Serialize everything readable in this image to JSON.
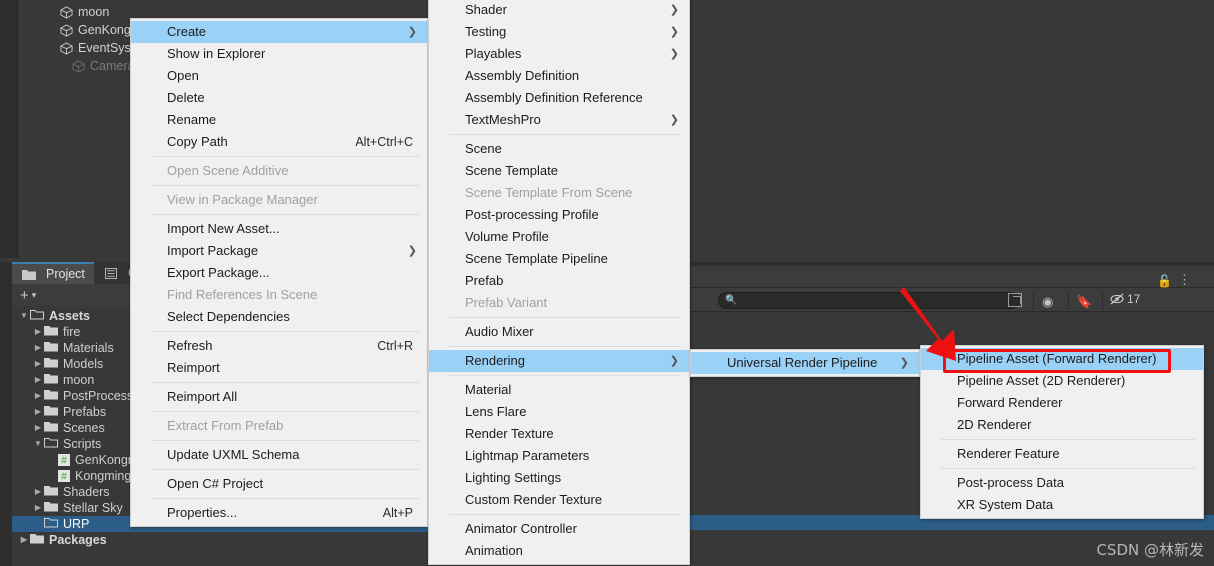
{
  "hierarchy": {
    "items": [
      {
        "label": "moon",
        "dim": false
      },
      {
        "label": "GenKong",
        "dim": false
      },
      {
        "label": "EventSys",
        "dim": false
      },
      {
        "label": "Camera",
        "dim": true
      }
    ]
  },
  "project_panel": {
    "tabs": [
      {
        "label": "Project",
        "icon": "folder-icon",
        "active": true
      },
      {
        "label": "Con",
        "icon": "console-icon",
        "active": false
      }
    ],
    "toolbar": {
      "add_label": "+",
      "dropdown_caret": "▾"
    },
    "tree": [
      {
        "label": "Assets",
        "depth": 0,
        "arrow": "▼",
        "icon": "folder-open-icon",
        "bold": true,
        "selected": false
      },
      {
        "label": "fire",
        "depth": 1,
        "arrow": "▶",
        "icon": "folder-icon",
        "bold": false,
        "selected": false
      },
      {
        "label": "Materials",
        "depth": 1,
        "arrow": "▶",
        "icon": "folder-icon",
        "bold": false,
        "selected": false
      },
      {
        "label": "Models",
        "depth": 1,
        "arrow": "▶",
        "icon": "folder-icon",
        "bold": false,
        "selected": false
      },
      {
        "label": "moon",
        "depth": 1,
        "arrow": "▶",
        "icon": "folder-icon",
        "bold": false,
        "selected": false
      },
      {
        "label": "PostProcess",
        "depth": 1,
        "arrow": "▶",
        "icon": "folder-icon",
        "bold": false,
        "selected": false
      },
      {
        "label": "Prefabs",
        "depth": 1,
        "arrow": "▶",
        "icon": "folder-icon",
        "bold": false,
        "selected": false
      },
      {
        "label": "Scenes",
        "depth": 1,
        "arrow": "▶",
        "icon": "folder-icon",
        "bold": false,
        "selected": false
      },
      {
        "label": "Scripts",
        "depth": 1,
        "arrow": "▼",
        "icon": "folder-open-icon",
        "bold": false,
        "selected": false
      },
      {
        "label": "GenKongmi",
        "depth": 2,
        "arrow": "",
        "icon": "csharp-script-icon",
        "bold": false,
        "selected": false
      },
      {
        "label": "KongmingLa",
        "depth": 2,
        "arrow": "",
        "icon": "csharp-script-icon",
        "bold": false,
        "selected": false
      },
      {
        "label": "Shaders",
        "depth": 1,
        "arrow": "▶",
        "icon": "folder-icon",
        "bold": false,
        "selected": false
      },
      {
        "label": "Stellar Sky",
        "depth": 1,
        "arrow": "▶",
        "icon": "folder-icon",
        "bold": false,
        "selected": false
      },
      {
        "label": "URP",
        "depth": 1,
        "arrow": "",
        "icon": "folder-icon",
        "bold": false,
        "selected": true
      },
      {
        "label": "Packages",
        "depth": 0,
        "arrow": "▶",
        "icon": "folder-icon",
        "bold": true,
        "selected": false
      }
    ]
  },
  "inspector_toolbar": {
    "search_placeholder": "",
    "search_value": "",
    "hidden_count": "17",
    "lock_icon": "lock-open-icon",
    "kebab_icon": "more-options-icon",
    "search_icon": "search-icon",
    "expand_icon": "open-in-new-icon",
    "filter_icon": "filter-by-type-icon",
    "label_icon": "filter-by-label-icon",
    "visibility_icon": "hidden-objects-icon"
  },
  "watermark": {
    "text": "CSDN @林新发"
  },
  "menu_asset": {
    "items": [
      {
        "label": "Create",
        "shortcut": "",
        "submenu": true,
        "disabled": false,
        "highlighted": true,
        "sep_after": false
      },
      {
        "label": "Show in Explorer",
        "shortcut": "",
        "submenu": false,
        "disabled": false,
        "highlighted": false,
        "sep_after": false
      },
      {
        "label": "Open",
        "shortcut": "",
        "submenu": false,
        "disabled": false,
        "highlighted": false,
        "sep_after": false
      },
      {
        "label": "Delete",
        "shortcut": "",
        "submenu": false,
        "disabled": false,
        "highlighted": false,
        "sep_after": false
      },
      {
        "label": "Rename",
        "shortcut": "",
        "submenu": false,
        "disabled": false,
        "highlighted": false,
        "sep_after": false
      },
      {
        "label": "Copy Path",
        "shortcut": "Alt+Ctrl+C",
        "submenu": false,
        "disabled": false,
        "highlighted": false,
        "sep_after": true
      },
      {
        "label": "Open Scene Additive",
        "shortcut": "",
        "submenu": false,
        "disabled": true,
        "highlighted": false,
        "sep_after": true
      },
      {
        "label": "View in Package Manager",
        "shortcut": "",
        "submenu": false,
        "disabled": true,
        "highlighted": false,
        "sep_after": true
      },
      {
        "label": "Import New Asset...",
        "shortcut": "",
        "submenu": false,
        "disabled": false,
        "highlighted": false,
        "sep_after": false
      },
      {
        "label": "Import Package",
        "shortcut": "",
        "submenu": true,
        "disabled": false,
        "highlighted": false,
        "sep_after": false
      },
      {
        "label": "Export Package...",
        "shortcut": "",
        "submenu": false,
        "disabled": false,
        "highlighted": false,
        "sep_after": false
      },
      {
        "label": "Find References In Scene",
        "shortcut": "",
        "submenu": false,
        "disabled": true,
        "highlighted": false,
        "sep_after": false
      },
      {
        "label": "Select Dependencies",
        "shortcut": "",
        "submenu": false,
        "disabled": false,
        "highlighted": false,
        "sep_after": true
      },
      {
        "label": "Refresh",
        "shortcut": "Ctrl+R",
        "submenu": false,
        "disabled": false,
        "highlighted": false,
        "sep_after": false
      },
      {
        "label": "Reimport",
        "shortcut": "",
        "submenu": false,
        "disabled": false,
        "highlighted": false,
        "sep_after": true
      },
      {
        "label": "Reimport All",
        "shortcut": "",
        "submenu": false,
        "disabled": false,
        "highlighted": false,
        "sep_after": true
      },
      {
        "label": "Extract From Prefab",
        "shortcut": "",
        "submenu": false,
        "disabled": true,
        "highlighted": false,
        "sep_after": true
      },
      {
        "label": "Update UXML Schema",
        "shortcut": "",
        "submenu": false,
        "disabled": false,
        "highlighted": false,
        "sep_after": true
      },
      {
        "label": "Open C# Project",
        "shortcut": "",
        "submenu": false,
        "disabled": false,
        "highlighted": false,
        "sep_after": true
      },
      {
        "label": "Properties...",
        "shortcut": "Alt+P",
        "submenu": false,
        "disabled": false,
        "highlighted": false,
        "sep_after": false
      }
    ]
  },
  "menu_create": {
    "items": [
      {
        "label": "Shader",
        "submenu": true,
        "disabled": false,
        "highlighted": false,
        "sep_after": false
      },
      {
        "label": "Testing",
        "submenu": true,
        "disabled": false,
        "highlighted": false,
        "sep_after": false
      },
      {
        "label": "Playables",
        "submenu": true,
        "disabled": false,
        "highlighted": false,
        "sep_after": false
      },
      {
        "label": "Assembly Definition",
        "submenu": false,
        "disabled": false,
        "highlighted": false,
        "sep_after": false
      },
      {
        "label": "Assembly Definition Reference",
        "submenu": false,
        "disabled": false,
        "highlighted": false,
        "sep_after": false
      },
      {
        "label": "TextMeshPro",
        "submenu": true,
        "disabled": false,
        "highlighted": false,
        "sep_after": true
      },
      {
        "label": "Scene",
        "submenu": false,
        "disabled": false,
        "highlighted": false,
        "sep_after": false
      },
      {
        "label": "Scene Template",
        "submenu": false,
        "disabled": false,
        "highlighted": false,
        "sep_after": false
      },
      {
        "label": "Scene Template From Scene",
        "submenu": false,
        "disabled": true,
        "highlighted": false,
        "sep_after": false
      },
      {
        "label": "Post-processing Profile",
        "submenu": false,
        "disabled": false,
        "highlighted": false,
        "sep_after": false
      },
      {
        "label": "Volume Profile",
        "submenu": false,
        "disabled": false,
        "highlighted": false,
        "sep_after": false
      },
      {
        "label": "Scene Template Pipeline",
        "submenu": false,
        "disabled": false,
        "highlighted": false,
        "sep_after": false
      },
      {
        "label": "Prefab",
        "submenu": false,
        "disabled": false,
        "highlighted": false,
        "sep_after": false
      },
      {
        "label": "Prefab Variant",
        "submenu": false,
        "disabled": true,
        "highlighted": false,
        "sep_after": true
      },
      {
        "label": "Audio Mixer",
        "submenu": false,
        "disabled": false,
        "highlighted": false,
        "sep_after": true
      },
      {
        "label": "Rendering",
        "submenu": true,
        "disabled": false,
        "highlighted": true,
        "sep_after": true
      },
      {
        "label": "Material",
        "submenu": false,
        "disabled": false,
        "highlighted": false,
        "sep_after": false
      },
      {
        "label": "Lens Flare",
        "submenu": false,
        "disabled": false,
        "highlighted": false,
        "sep_after": false
      },
      {
        "label": "Render Texture",
        "submenu": false,
        "disabled": false,
        "highlighted": false,
        "sep_after": false
      },
      {
        "label": "Lightmap Parameters",
        "submenu": false,
        "disabled": false,
        "highlighted": false,
        "sep_after": false
      },
      {
        "label": "Lighting Settings",
        "submenu": false,
        "disabled": false,
        "highlighted": false,
        "sep_after": false
      },
      {
        "label": "Custom Render Texture",
        "submenu": false,
        "disabled": false,
        "highlighted": false,
        "sep_after": true
      },
      {
        "label": "Animator Controller",
        "submenu": false,
        "disabled": false,
        "highlighted": false,
        "sep_after": false
      },
      {
        "label": "Animation",
        "submenu": false,
        "disabled": false,
        "highlighted": false,
        "sep_after": false
      }
    ]
  },
  "menu_rendering": {
    "items": [
      {
        "label": "Universal Render Pipeline",
        "submenu": true,
        "disabled": false,
        "highlighted": true,
        "sep_after": false
      }
    ]
  },
  "menu_urp": {
    "items": [
      {
        "label": "Pipeline Asset (Forward Renderer)",
        "submenu": false,
        "disabled": false,
        "highlighted": true,
        "sep_after": false,
        "annotated": true
      },
      {
        "label": "Pipeline Asset (2D Renderer)",
        "submenu": false,
        "disabled": false,
        "highlighted": false,
        "sep_after": false,
        "annotated": false
      },
      {
        "label": "Forward Renderer",
        "submenu": false,
        "disabled": false,
        "highlighted": false,
        "sep_after": false,
        "annotated": false
      },
      {
        "label": "2D Renderer",
        "submenu": false,
        "disabled": false,
        "highlighted": false,
        "sep_after": true,
        "annotated": false
      },
      {
        "label": "Renderer Feature",
        "submenu": false,
        "disabled": false,
        "highlighted": false,
        "sep_after": true,
        "annotated": false
      },
      {
        "label": "Post-process Data",
        "submenu": false,
        "disabled": false,
        "highlighted": false,
        "sep_after": false,
        "annotated": false
      },
      {
        "label": "XR System Data",
        "submenu": false,
        "disabled": false,
        "highlighted": false,
        "sep_after": false,
        "annotated": false
      }
    ]
  },
  "annotation": {
    "highlight_color": "#ee1111",
    "arrow_color": "#ee1111",
    "target_label": "Pipeline Asset (Forward Renderer)"
  }
}
